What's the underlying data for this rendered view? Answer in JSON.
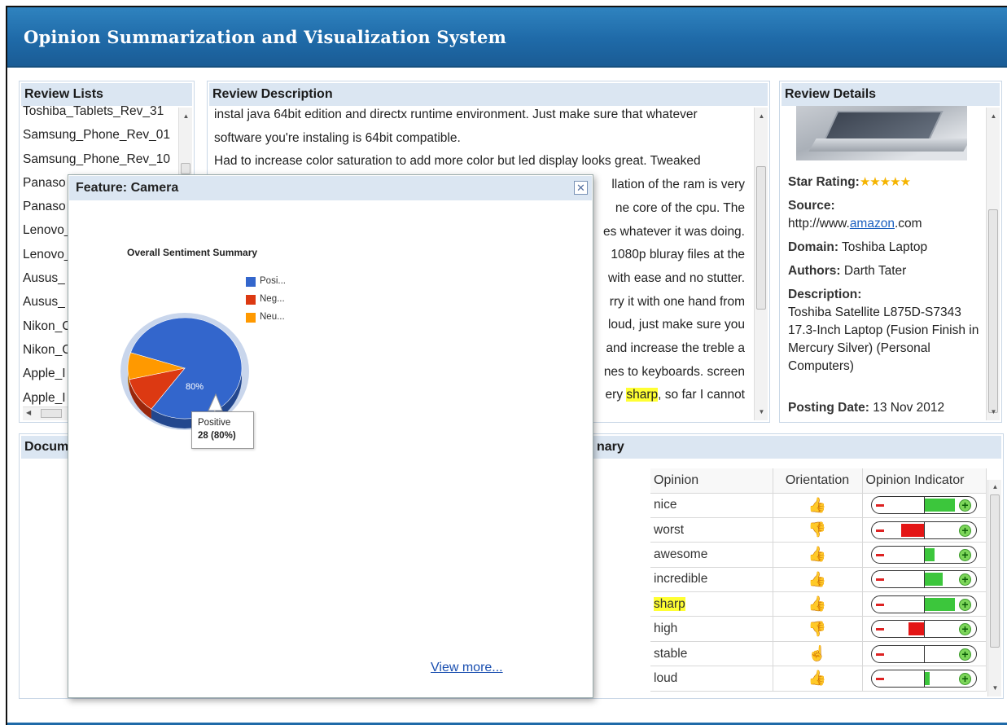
{
  "app": {
    "title": "Opinion Summarization and Visualization System"
  },
  "review_lists": {
    "title": "Review Lists",
    "items": [
      "Toshiba_Tablets_Rev_31",
      "Samsung_Phone_Rev_01",
      "Samsung_Phone_Rev_10",
      "Panaso",
      "Panaso",
      "Lenovo_",
      "Lenovo_",
      "Ausus_",
      "Ausus_",
      "Nikon_C",
      "Nikon_C",
      "Apple_I",
      "Apple_I"
    ]
  },
  "review_description": {
    "title": "Review Description",
    "line0": "instal java 64bit edition and directx runtime environment. Just make sure that whatever",
    "line1": "software you're instaling is 64bit compatible.",
    "line2": "Had to increase color saturation to add more color but led display looks great. Tweaked",
    "line3": "llation of the ram is very",
    "line4": "ne core of the cpu. The",
    "line5": "es whatever it was doing.",
    "line6": "1080p bluray files at the",
    "line7": "with ease and no stutter.",
    "line8": "rry it with one hand from",
    "line9": "loud, just make sure you",
    "line10": "and increase the treble a",
    "line11": "nes to keyboards. screen",
    "line12_pre": "ery ",
    "line12_hl": "sharp",
    "line12_post": ", so far I cannot"
  },
  "review_details": {
    "title": "Review Details",
    "star_label": "Star Rating:",
    "stars": "★★★★★",
    "source_label": "Source:",
    "source_pre": "http://www.",
    "source_link": "amazon",
    "source_post": ".com",
    "domain_label": "Domain:",
    "domain": "Toshiba Laptop",
    "authors_label": "Authors:",
    "authors": "Darth Tater",
    "description_label": "Description:",
    "description": "Toshiba Satellite L875D-S7343 17.3-Inch Laptop (Fusion Finish in Mercury Silver) (Personal Computers)",
    "posting_label": "Posting Date:",
    "posting_date": "13 Nov 2012"
  },
  "document_panel": {
    "title_left": "Docum",
    "title_right": "nary",
    "columns": {
      "opinion": "Opinion",
      "orientation": "Orientation",
      "indicator": "Opinion Indicator"
    },
    "rows": [
      {
        "opinion": "nice",
        "orientation": "positive",
        "indicator": 0.6
      },
      {
        "opinion": "worst",
        "orientation": "negative",
        "indicator": -0.45
      },
      {
        "opinion": "awesome",
        "orientation": "positive",
        "indicator": 0.2
      },
      {
        "opinion": "incredible",
        "orientation": "positive",
        "indicator": 0.35
      },
      {
        "opinion": "sharp",
        "orientation": "positive",
        "indicator": 0.6,
        "highlight": true
      },
      {
        "opinion": "high",
        "orientation": "negative",
        "indicator": -0.3
      },
      {
        "opinion": "stable",
        "orientation": "neutral",
        "indicator": 0.0
      },
      {
        "opinion": "loud",
        "orientation": "positive",
        "indicator": 0.1
      }
    ]
  },
  "popup": {
    "title": "Feature: Camera",
    "close_label": "✕",
    "view_more": "View more..."
  },
  "chart_data": {
    "type": "pie",
    "title": "Overall Sentiment Summary",
    "categories": [
      "Posi...",
      "Neg...",
      "Neu..."
    ],
    "values": [
      28,
      4,
      3
    ],
    "colors": [
      "#3366cc",
      "#dc3912",
      "#ff9900"
    ],
    "slice_label": "80%",
    "tooltip": {
      "name": "Positive",
      "value": "28 (80%)"
    },
    "legend_position": "right"
  }
}
